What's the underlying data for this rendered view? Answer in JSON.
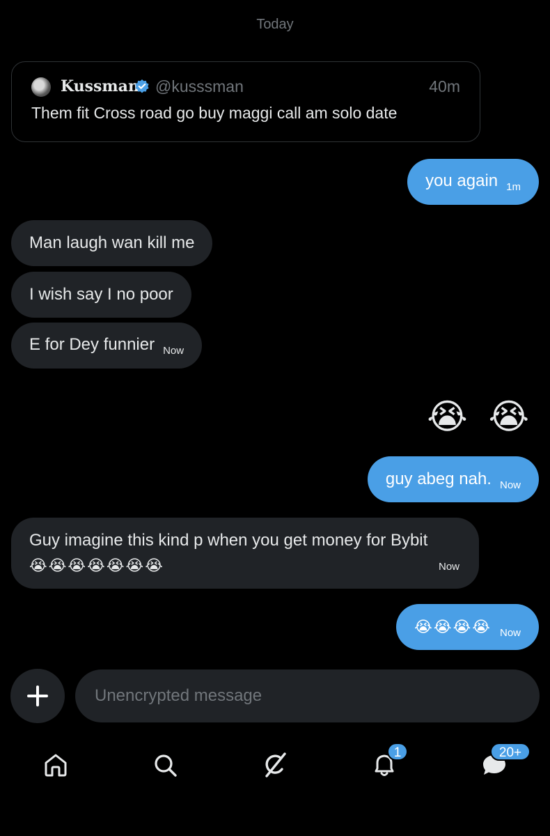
{
  "conversation": {
    "day_label": "Today"
  },
  "quoted_post": {
    "name": "Kussman",
    "handle": "@kusssman",
    "time": "40m",
    "text": "Them fit Cross road go buy maggi call am solo date",
    "avatar_icon": "avatar-photo",
    "verified_icon": "verified-badge-icon"
  },
  "messages": [
    {
      "side": "out",
      "text": "you again",
      "time": "1m"
    },
    {
      "side": "in",
      "text": "Man laugh wan kill me"
    },
    {
      "side": "in",
      "text": "I wish say I no poor"
    },
    {
      "side": "in",
      "text": "E for Dey funnier",
      "time": "Now"
    },
    {
      "side": "out",
      "text": "😭 😭"
    },
    {
      "side": "out",
      "text": "guy abeg nah.",
      "time": "Now"
    },
    {
      "side": "in",
      "text": "Guy imagine this kind p when you get money for Bybit",
      "text_line2": "😭😭😭😭😭😭😭",
      "time": "Now"
    },
    {
      "side": "out",
      "text": "😭😭😭😭",
      "time": "Now"
    }
  ],
  "composer": {
    "placeholder": "Unencrypted message",
    "add_icon": "plus-icon"
  },
  "nav": {
    "items": [
      {
        "icon": "home-icon"
      },
      {
        "icon": "search-icon"
      },
      {
        "icon": "grok-icon"
      },
      {
        "icon": "bell-icon",
        "badge": "1"
      },
      {
        "icon": "messages-icon",
        "badge": "20+"
      }
    ]
  },
  "colors": {
    "background": "#000000",
    "incoming_bubble": "#202327",
    "outgoing_bubble": "#4a9fe6",
    "secondary_text": "#71767b"
  }
}
